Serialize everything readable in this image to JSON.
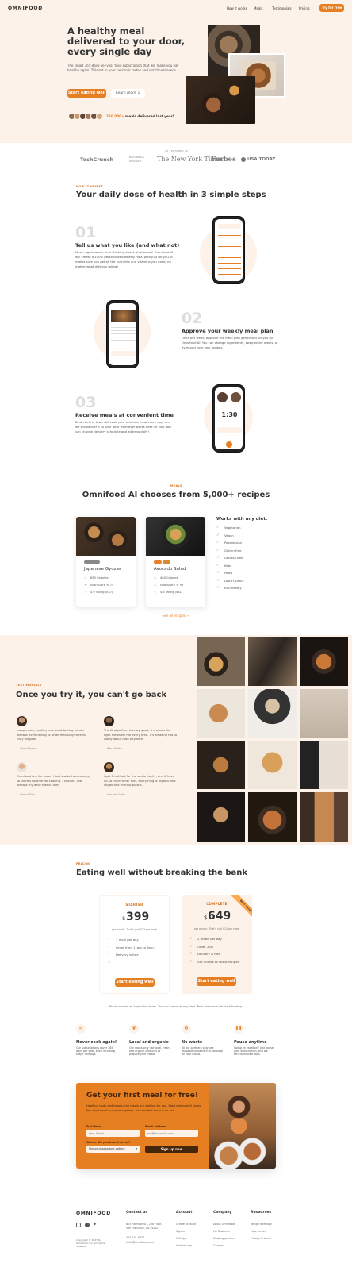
{
  "header": {
    "logo": "OMNIFOOD",
    "nav": [
      "How it works",
      "Meals",
      "Testimonials",
      "Pricing"
    ],
    "cta": "Try for free"
  },
  "hero": {
    "title": "A healthy meal delivered to your door, every single day",
    "description": "The smart 365-days-per-year food subscription that will make you eat healthy again. Tailored to your personal tastes and nutritional needs.",
    "primary_cta": "Start eating well",
    "secondary_cta": "Learn more ↓",
    "delivered_count": "250,000+",
    "delivered_text": "meals delivered last year!"
  },
  "featured": {
    "label": "AS FEATURED IN",
    "logos": [
      "TechCrunch",
      "BUSINESS INSIDER",
      "The New York Times",
      "Forbes",
      "USA TODAY"
    ]
  },
  "how": {
    "subheading": "HOW IT WORKS",
    "title": "Your daily dose of health in 3 simple steps",
    "steps": [
      {
        "number": "01",
        "title": "Tell us what you like (and what not)",
        "text": "Never again waste time thinking about what to eat! Omnifood AI will create a 100% personalized weekly meal plan just for you. It makes sure you get all the nutrients and vitamins you need, no matter what diet you follow!"
      },
      {
        "number": "02",
        "title": "Approve your weekly meal plan",
        "text": "Once per week, approve the meal plan generated for you by Omnifood AI. You can change ingredients, swap entire meals, or even add your own recipes."
      },
      {
        "number": "03",
        "title": "Receive meals at convenient time",
        "text": "Best chefs in town will cook your selected meal every day, and we will deliver it to your door whenever works best for you. You can change delivery schedule and address daily!"
      }
    ],
    "phone_time": "1:30"
  },
  "meals": {
    "subheading": "MEALS",
    "title": "Omnifood AI chooses from 5,000+ recipes",
    "cards": [
      {
        "name": "Japanese Gyozas",
        "calories": "650 Calories",
        "nutri": "NutriScore ® 74",
        "rating": "4.9 rating (537)"
      },
      {
        "name": "Avocado Salad",
        "calories": "400 Calories",
        "nutri": "NutriScore ® 92",
        "rating": "4.8 rating (441)"
      }
    ],
    "diets_title": "Works with any diet:",
    "diets": [
      "Vegetarian",
      "Vegan",
      "Pescatarian",
      "Gluten-free",
      "Lactose-free",
      "Keto",
      "Paleo",
      "Low FODMAP",
      "Kid-friendly"
    ],
    "all_link": "See all recipes →"
  },
  "testimonials": {
    "subheading": "TESTIMONIALS",
    "title": "Once you try it, you can't go back",
    "items": [
      {
        "text": "Inexpensive, healthy and great-tasting meals, without even having to order manually! It feels truly magical.",
        "name": "— Dave Bryson"
      },
      {
        "text": "The AI algorithm is crazy good, it chooses the right meals for me every time. It's amazing not to worry about food anymore!",
        "name": "— Ben Hadley"
      },
      {
        "text": "Omnifood is a life saver! I just started a company, so there's no time for cooking. I couldn't live without my daily meals now!",
        "name": "— Steve Miller"
      },
      {
        "text": "I got Omnifood for the whole family, and it frees up so much time! Plus, everything is organic and vegan and without plastic.",
        "name": "— Hannah Smith"
      }
    ]
  },
  "pricing": {
    "subheading": "PRICING",
    "title": "Eating well without breaking the bank",
    "plans": [
      {
        "name": "STARTER",
        "price": "399",
        "sub": "per month. That's just $13 per meal",
        "features": [
          "1 meal per day",
          "Order from 11am to 9pm",
          "Delivery is free",
          ""
        ],
        "cta": "Start eating well"
      },
      {
        "name": "COMPLETE",
        "price": "649",
        "sub": "per month. That's just $11 per meal",
        "features": [
          "2 meals per day",
          "Order 24/7",
          "Delivery is free",
          "Get access to latest recipes"
        ],
        "cta": "Start eating well",
        "badge": "BEST VALUE"
      }
    ],
    "note": "Prices include all applicable taxes. You can cancel at any time. Both plans include the following:",
    "features": [
      {
        "title": "Never cook again!",
        "text": "Our subscriptions cover 365 days per year, even including major holidays."
      },
      {
        "title": "Local and organic",
        "text": "Our cooks only use local, fresh, and organic products to prepare your meals."
      },
      {
        "title": "No waste",
        "text": "All our partners only use reusable containers to package all your meals."
      },
      {
        "title": "Pause anytime",
        "text": "Going on vacation? Just pause your subscription, and we refund unused days."
      }
    ]
  },
  "cta_section": {
    "title": "Get your first meal for free!",
    "text": "Healthy, tasty and hassle-free meals are waiting for you. Start eating well today. You can cancel or pause anytime. And the first meal is on us!",
    "name_label": "Full Name",
    "name_placeholder": "John Smith",
    "email_label": "Email Address",
    "email_placeholder": "me@example.com",
    "source_label": "Where did you hear from us?",
    "source_value": "Please choose one option:",
    "submit": "Sign up now"
  },
  "footer": {
    "logo": "OMNIFOOD",
    "copyright": "Copyright © 2027 by Omnifood, Inc. All rights reserved.",
    "contact_title": "Contact us",
    "address": "623 Harrison St., 2nd Floor, San Francisco, CA 94107",
    "phone": "415-201-6370",
    "email": "hello@omnifood.com",
    "account_title": "Account",
    "account": [
      "Create account",
      "Sign in",
      "iOS app",
      "Android app"
    ],
    "company_title": "Company",
    "company": [
      "About Omnifood",
      "For Business",
      "Cooking partners",
      "Careers"
    ],
    "resources_title": "Resources",
    "resources": [
      "Recipe directory",
      "Help center",
      "Privacy & terms"
    ]
  },
  "colors": {
    "accent": "#e67e22",
    "tint": "#fdf2e9",
    "dark": "#333333"
  }
}
